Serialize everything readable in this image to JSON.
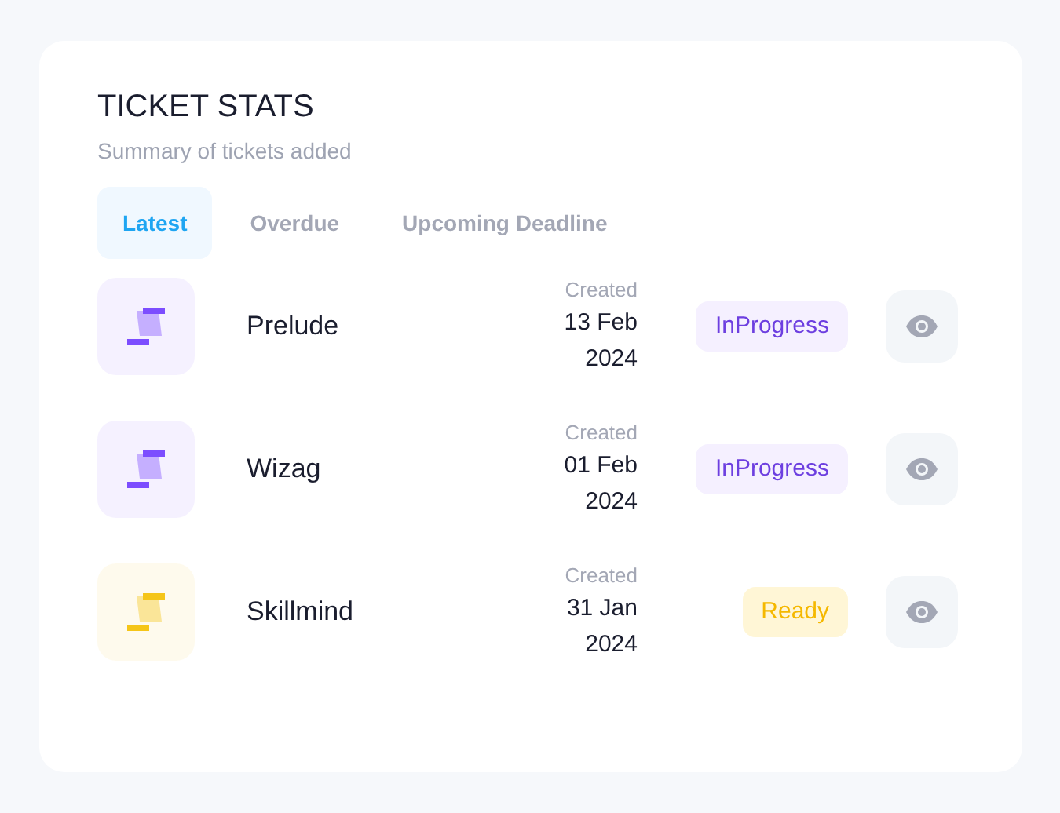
{
  "card": {
    "title": "TICKET STATS",
    "subtitle": "Summary of tickets added"
  },
  "tabs": [
    {
      "label": "Latest",
      "selected": true
    },
    {
      "label": "Overdue",
      "selected": false
    },
    {
      "label": "Upcoming Deadline",
      "selected": false
    }
  ],
  "tickets": [
    {
      "name": "Prelude",
      "color": "#7c4dff",
      "created_label": "Created",
      "date": "13 Feb",
      "year": "2024",
      "status": {
        "label": "InProgress",
        "kind": "progress"
      }
    },
    {
      "name": "Wizag",
      "color": "#7c4dff",
      "created_label": "Created",
      "date": "01 Feb",
      "year": "2024",
      "status": {
        "label": "InProgress",
        "kind": "progress"
      }
    },
    {
      "name": "Skillmind",
      "color": "#f5c518",
      "created_label": "Created",
      "date": "31 Jan",
      "year": "2024",
      "status": {
        "label": "Ready",
        "kind": "ready"
      }
    }
  ]
}
